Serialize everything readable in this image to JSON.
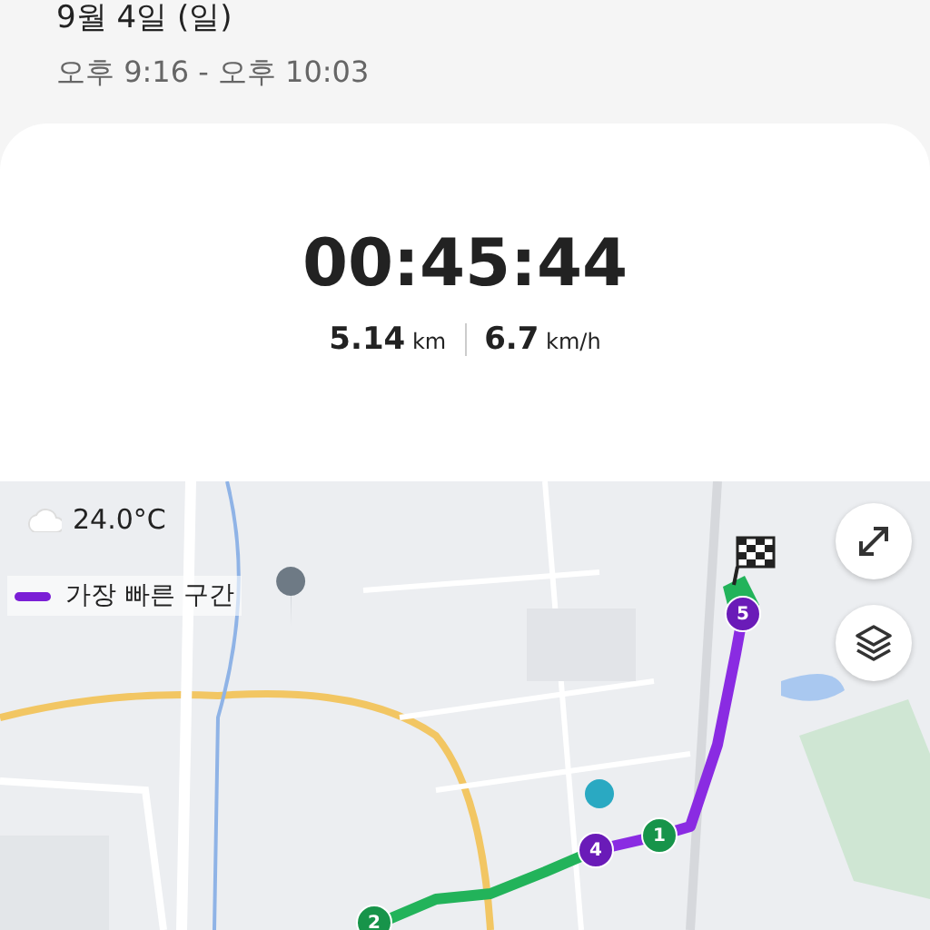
{
  "header": {
    "date": "9월 4일 (일)",
    "time_range": "오후 9:16 - 오후 10:03"
  },
  "summary": {
    "duration": "00:45:44",
    "stats": [
      {
        "value": "5.14",
        "unit": "km"
      },
      {
        "value": "6.7",
        "unit": "km/h"
      }
    ]
  },
  "map": {
    "weather": {
      "temperature": "24.0°C"
    },
    "legend": {
      "label": "가장 빠른 구간",
      "color": "#7b1fd6"
    },
    "controls": [
      {
        "kind": "expand"
      },
      {
        "kind": "layers"
      }
    ],
    "markers": [
      {
        "label": "5",
        "color": "#6a1bb8"
      },
      {
        "label": "1",
        "color": "#17944a"
      },
      {
        "label": "4",
        "color": "#6a1bb8"
      },
      {
        "label": "2",
        "color": "#17944a"
      }
    ]
  }
}
